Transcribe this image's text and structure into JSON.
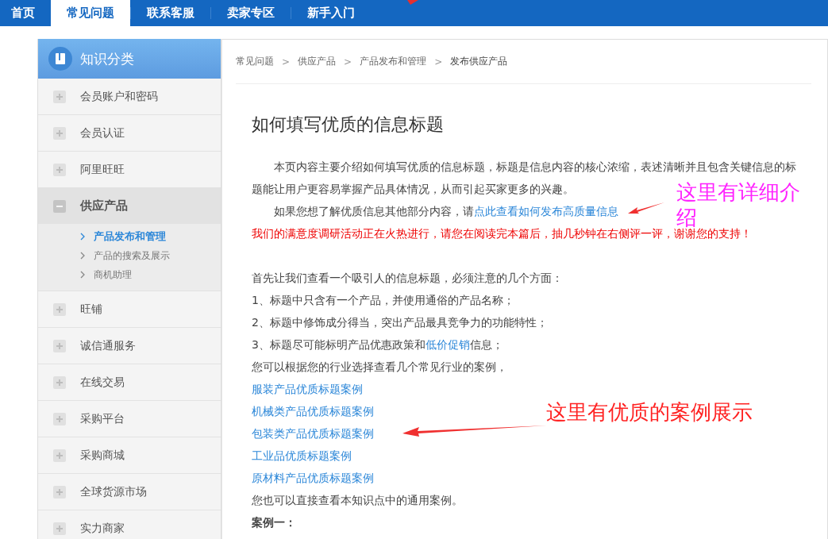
{
  "nav": {
    "tabs": [
      {
        "label": "首页",
        "selected": false
      },
      {
        "label": "常见问题",
        "selected": true
      },
      {
        "label": "联系客服",
        "selected": false
      },
      {
        "label": "卖家专区",
        "selected": false
      },
      {
        "label": "新手入门",
        "selected": false
      }
    ]
  },
  "sidebar": {
    "title": "知识分类",
    "items": [
      {
        "label": "会员账户和密码",
        "expanded": false
      },
      {
        "label": "会员认证",
        "expanded": false
      },
      {
        "label": "阿里旺旺",
        "expanded": false
      },
      {
        "label": "供应产品",
        "expanded": true,
        "children": [
          {
            "label": "产品发布和管理",
            "selected": true
          },
          {
            "label": "产品的搜索及展示",
            "selected": false
          },
          {
            "label": "商机助理",
            "selected": false
          }
        ]
      },
      {
        "label": "旺铺",
        "expanded": false
      },
      {
        "label": "诚信通服务",
        "expanded": false
      },
      {
        "label": "在线交易",
        "expanded": false
      },
      {
        "label": "采购平台",
        "expanded": false
      },
      {
        "label": "采购商城",
        "expanded": false
      },
      {
        "label": "全球货源市场",
        "expanded": false
      },
      {
        "label": "实力商家",
        "expanded": false
      }
    ]
  },
  "breadcrumb": {
    "items": [
      "常见问题",
      "供应产品",
      "产品发布和管理",
      "发布供应产品"
    ],
    "separator": ">"
  },
  "article": {
    "title": "如何填写优质的信息标题",
    "blocks": [
      {
        "kind": "intro",
        "lines": [
          "本页内容主要介绍如何填写优质的信息标题，标题是信息内容的核心浓缩，表述清晰并且包含关键信息的标",
          "题能让用户更容易掌握产品具体情况，从而引起买家更多的兴趣。"
        ]
      },
      {
        "kind": "intro_link",
        "text": "如果您想了解优质信息其他部分内容，请",
        "link": "点此查看如何发布高质量信息"
      },
      {
        "kind": "notice",
        "text": "我们的满意度调研活动正在火热进行，请您在阅读完本篇后，抽几秒钟在右侧评一评，谢谢您的支持！"
      },
      {
        "kind": "gap"
      },
      {
        "kind": "line",
        "text": "首先让我们查看一个吸引人的信息标题，必须注意的几个方面："
      },
      {
        "kind": "line",
        "text": "1、标题中只含有一个产品，并使用通俗的产品名称；"
      },
      {
        "kind": "line",
        "text": "2、标题中修饰成分得当，突出产品最具竞争力的功能特性；"
      },
      {
        "kind": "line_link",
        "text": "3、标题尽可能标明产品优惠政策和",
        "link": "低价促销",
        "after": "信息；"
      },
      {
        "kind": "line",
        "text": "您可以根据您的行业选择查看几个常见行业的案例，"
      },
      {
        "kind": "link",
        "text": "服装产品优质标题案例"
      },
      {
        "kind": "link",
        "text": "机械类产品优质标题案例"
      },
      {
        "kind": "link",
        "text": "包装类产品优质标题案例"
      },
      {
        "kind": "link",
        "text": "工业品优质标题案例"
      },
      {
        "kind": "link",
        "text": "原材料产品优质标题案例"
      },
      {
        "kind": "line",
        "text": "您也可以直接查看本知识点中的通用案例。"
      },
      {
        "kind": "heading",
        "text": "案例一："
      }
    ]
  },
  "annotations": [
    {
      "text": "这里有详细介绍",
      "color": "#ff22ff"
    },
    {
      "text": "这里有优质的案例展示",
      "color": "#ff2222"
    }
  ]
}
